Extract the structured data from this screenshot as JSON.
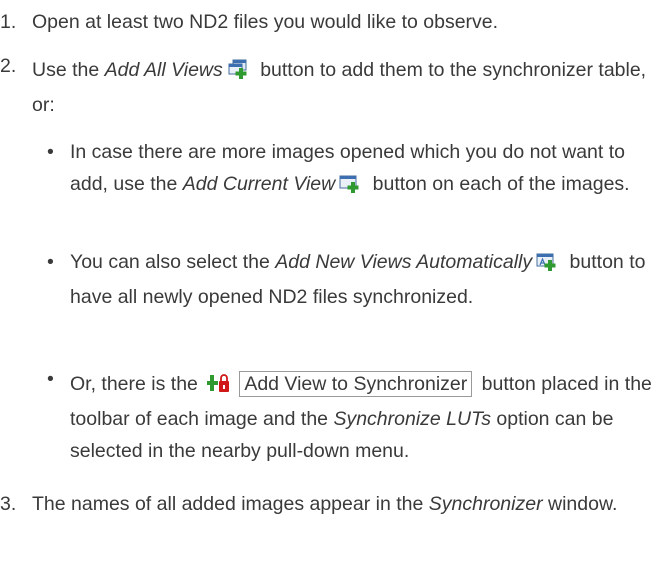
{
  "steps": [
    {
      "number": "1.",
      "text": "Open at least two ND2 files you would like to observe."
    },
    {
      "number": "2.",
      "pre": "Use the ",
      "em": "Add All Views",
      "post": " button to add them to the synchronizer table, or:"
    },
    {
      "number": "3.",
      "pre": "The names of all added images appear in the ",
      "em": "Synchronizer",
      "post": " window."
    }
  ],
  "bullets": [
    {
      "marker": "•",
      "pre": "In case there are more images opened which you do not want to add, use the ",
      "em": "Add Current View",
      "post": " button on each of the images."
    },
    {
      "marker": "•",
      "pre": "You can also select the ",
      "em": "Add New Views Automatically",
      "post": " button to have all newly opened ND2 files synchronized."
    },
    {
      "marker": "•",
      "pre": "Or, there is the ",
      "button": "Add View to Synchronizer",
      "mid": " button placed in the toolbar of each image and the ",
      "em": "Synchronize LUTs",
      "post": " option can be selected in the nearby pull-down menu."
    }
  ],
  "icons": [
    "add-all-views-icon",
    "add-current-view-icon",
    "add-new-views-automatically-icon",
    "add-view-to-synchronizer-icon"
  ]
}
